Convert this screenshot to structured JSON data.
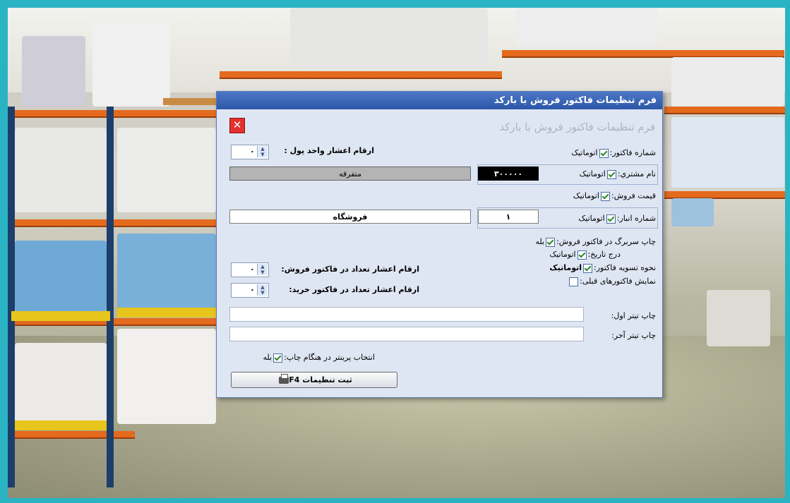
{
  "dialog": {
    "title": "فرم تنظیمات فاکتور فروش با بارکد",
    "watermark": "فرم تنظیمات فاکتور فروش با بارکد",
    "close_icon": "close-icon",
    "check_label": "اتوماتیک",
    "invoice_number": {
      "label": "شماره فاکتور:",
      "checked": true
    },
    "currency_decimals": {
      "label": "ارقام اعشار واحد پول :",
      "value": "٠"
    },
    "customer_name": {
      "label": "نام مشتري:",
      "checked": true,
      "code": "٣٠٠٠٠٠",
      "name": "متفرقه"
    },
    "sale_price": {
      "label": "قیمت فروش:",
      "checked": true
    },
    "warehouse_number": {
      "label": "شماره انبار:",
      "checked": true,
      "code": "١",
      "name": "فروشگاه"
    },
    "print_header": {
      "label": "چاپ سربرگ در فاکتور فروش:",
      "checked": true,
      "option": "بله"
    },
    "insert_date": {
      "label": "درج تاریخ:",
      "checked": true,
      "option": "اتوماتیک"
    },
    "settlement": {
      "label": "نحوه تسویه فاکتور:",
      "checked": true,
      "option": "اتوماتیک"
    },
    "show_previous": {
      "label": "نمایش فاکتورهای قبلی:",
      "checked": false
    },
    "sale_qty_decimals": {
      "label": "ارقام اعشار تعداد در فاکتور فروش:",
      "value": "٠"
    },
    "purchase_qty_decimals": {
      "label": "ارقام اعشار تعداد در فاکتور خرید:",
      "value": "٠"
    },
    "first_title": {
      "label": "چاپ تیتر اول:",
      "value": ""
    },
    "last_title": {
      "label": "چاپ تیتر آخر:",
      "value": ""
    },
    "printer_select": {
      "label": "انتخاب پرینتر در هنگام چاپ:",
      "checked": true,
      "option": "بله"
    },
    "save_button": {
      "label": "ثبت تنظیمات F4",
      "icon": "printer-icon"
    }
  }
}
